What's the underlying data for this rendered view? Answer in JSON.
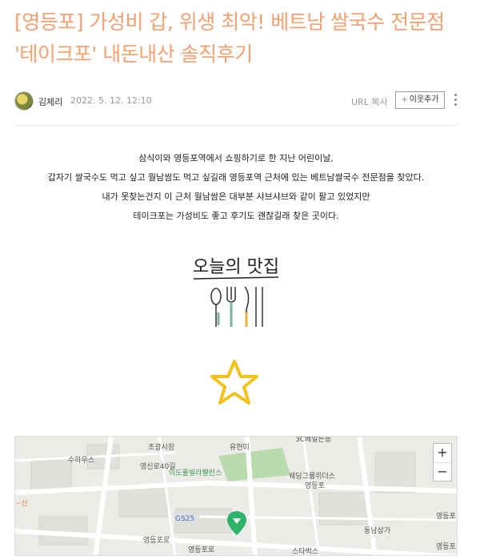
{
  "post": {
    "title_line1": "[영등포] 가성비 갑, 위생 최악! 베트남 쌀국수 전문점",
    "title_line2": "'테이크포' 내돈내산 솔직후기"
  },
  "meta": {
    "author": "김체리",
    "date": "2022. 5. 12. 12:10",
    "url_copy": "URL 복사",
    "add_neighbor": "이웃추가",
    "add_neighbor_plus": "+"
  },
  "body": {
    "lines": [
      "삼식이와 영등포역에서 쇼핑하기로 한 지난 어린이날,",
      "갑자기 쌀국수도 먹고 싶고 월남쌈도 먹고 싶길래 영등포역 근처에 있는 베트남쌀국수 전문점을 찾았다.",
      "내가 못찾는건지 이 근처 월남쌈은 대부분 샤브샤브와 같이 팔고 있었지만",
      "테이크포는 가성비도 좋고 후기도 괜찮길래 찾은 곳이다."
    ],
    "sticker_text": "오늘의 맛집"
  },
  "map": {
    "labels": {
      "jogwang": "조광시장",
      "yuhyeonmi": "유현미",
      "suhauseu": "수하우스",
      "yeongsin40": "영신로40길",
      "idopul": "이도풀빌라팰런스",
      "wedding": "웨딩그룹위더스",
      "yeongdeungpo": "영등포",
      "gs25": "GS25",
      "starbucks": "스타벅스",
      "dongnam": "동남상가",
      "yeongdeungpo_ro": "영등포로",
      "san": "~산",
      "top_right": "3C베일든동",
      "right_edge": "영등포",
      "right_edge2": "영등포"
    },
    "zoom_in": "+",
    "zoom_out": "−",
    "pin_color": "#2db36b"
  }
}
